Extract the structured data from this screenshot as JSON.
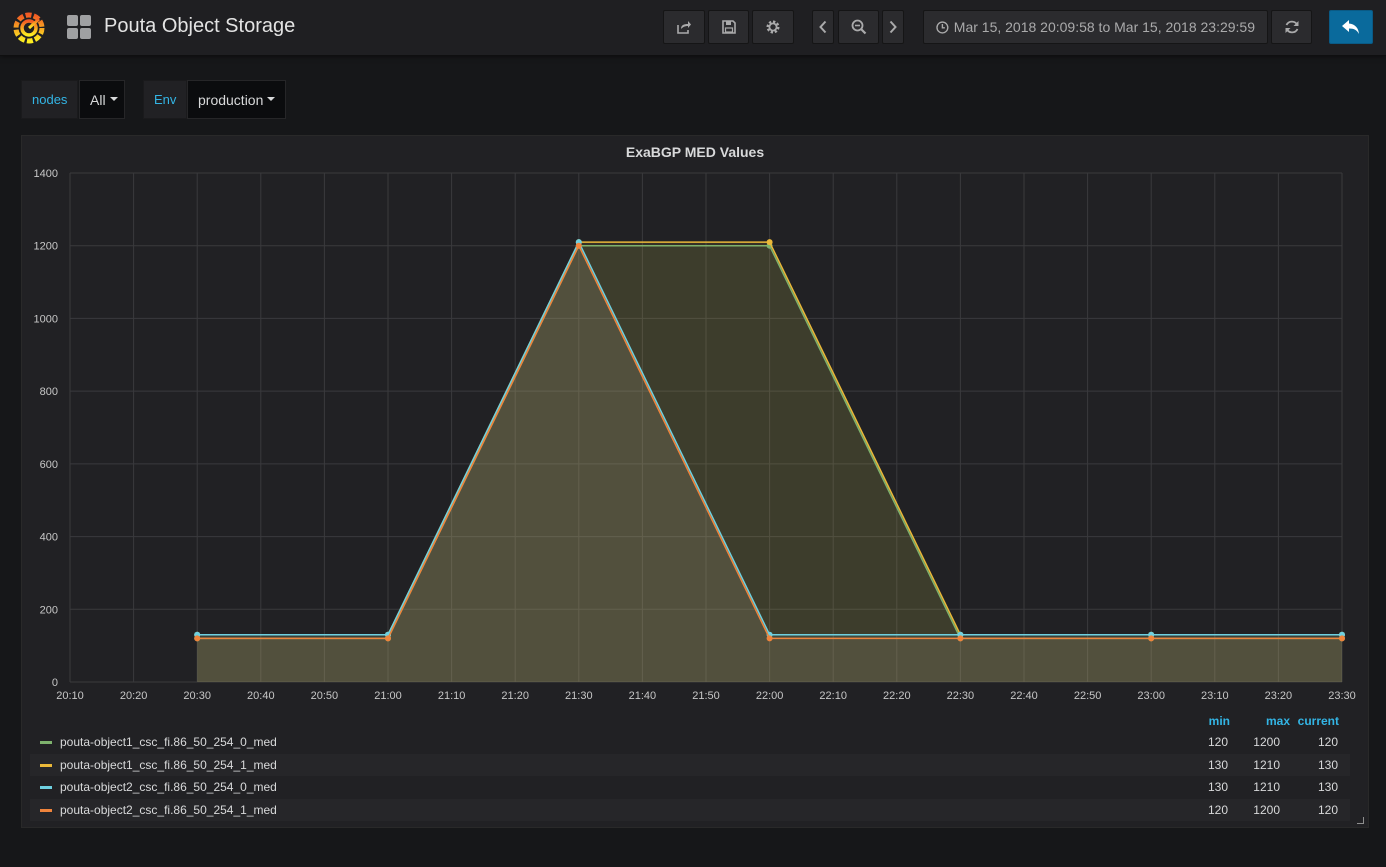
{
  "navbar": {
    "title": "Pouta Object Storage",
    "time_range": "Mar 15, 2018 20:09:58 to Mar 15, 2018 23:29:59",
    "icons": [
      "grafana-logo-icon",
      "dashboard-grid-icon",
      "share-icon",
      "save-icon",
      "settings-icon",
      "chevron-left-icon",
      "zoom-out-icon",
      "chevron-right-icon",
      "clock-icon",
      "refresh-icon",
      "back-arrow-icon"
    ]
  },
  "variables": [
    {
      "label": "nodes",
      "value": "All"
    },
    {
      "label": "Env",
      "value": "production"
    }
  ],
  "panel": {
    "legend_headers": {
      "min": "min",
      "max": "max",
      "current": "current"
    }
  },
  "chart_data": {
    "type": "area",
    "title": "ExaBGP MED Values",
    "x": [
      "20:30",
      "21:00",
      "21:30",
      "22:00",
      "22:30",
      "23:00",
      "23:30"
    ],
    "x_ticks": [
      "20:10",
      "20:20",
      "20:30",
      "20:40",
      "20:50",
      "21:00",
      "21:10",
      "21:20",
      "21:30",
      "21:40",
      "21:50",
      "22:00",
      "22:10",
      "22:20",
      "22:30",
      "22:40",
      "22:50",
      "23:00",
      "23:10",
      "23:20",
      "23:30"
    ],
    "xlim": [
      "20:10",
      "23:30"
    ],
    "ylim": [
      0,
      1400
    ],
    "y_ticks": [
      0,
      200,
      400,
      600,
      800,
      1000,
      1200,
      1400
    ],
    "grid": true,
    "legend_position": "bottom",
    "series": [
      {
        "name": "pouta-object1_csc_fi.86_50_254_0_med",
        "color": "#7eb26d",
        "values": [
          120,
          120,
          1200,
          1200,
          120,
          120,
          120
        ],
        "min": "120",
        "max": "1200",
        "current": "120"
      },
      {
        "name": "pouta-object1_csc_fi.86_50_254_1_med",
        "color": "#eab839",
        "values": [
          130,
          130,
          1210,
          1210,
          130,
          130,
          130
        ],
        "min": "130",
        "max": "1210",
        "current": "130"
      },
      {
        "name": "pouta-object2_csc_fi.86_50_254_0_med",
        "color": "#6ed0e0",
        "values": [
          130,
          130,
          1210,
          130,
          130,
          130,
          130
        ],
        "min": "130",
        "max": "1210",
        "current": "130"
      },
      {
        "name": "pouta-object2_csc_fi.86_50_254_1_med",
        "color": "#ef843c",
        "values": [
          120,
          120,
          1200,
          120,
          120,
          120,
          120
        ],
        "min": "120",
        "max": "1200",
        "current": "120"
      }
    ]
  }
}
